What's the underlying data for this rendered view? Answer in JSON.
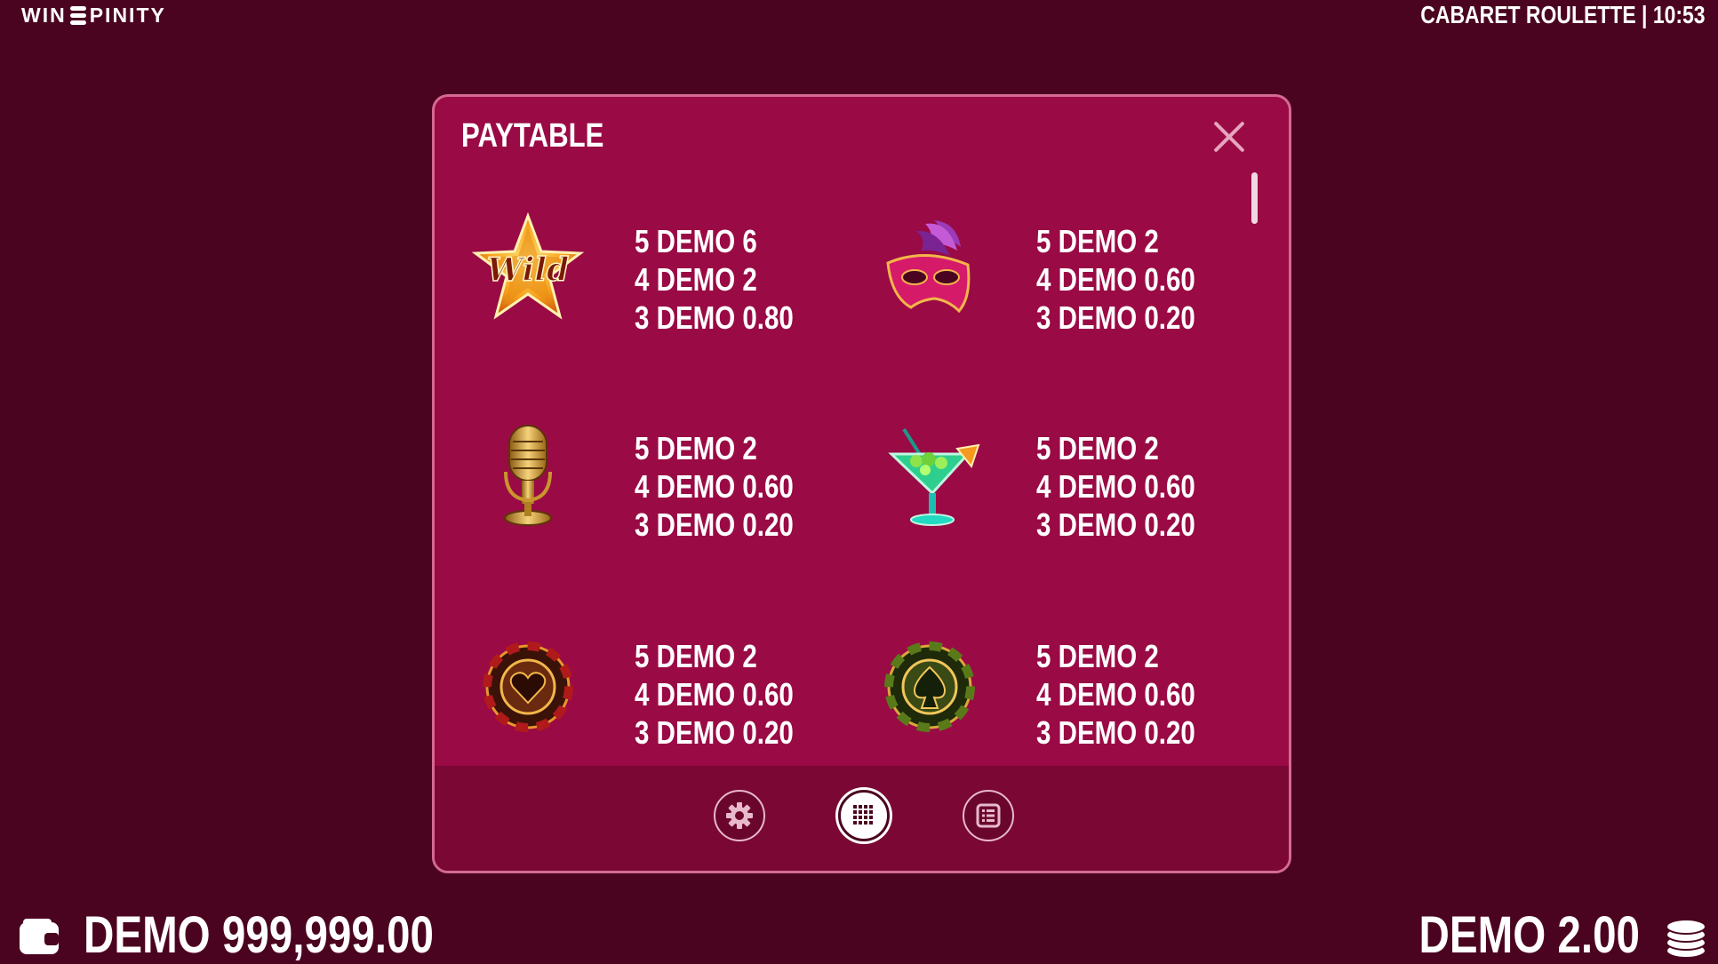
{
  "header": {
    "logo_text_left": "WIN",
    "logo_text_right": "PINITY",
    "game_title": "CABARET ROULETTE | 10:53"
  },
  "modal": {
    "title": "PAYTABLE",
    "items": [
      {
        "symbol": "wild-star-icon",
        "symbol_text": "Wild",
        "pays": [
          "5 DEMO 6",
          "4 DEMO 2",
          "3 DEMO 0.80"
        ]
      },
      {
        "symbol": "mask-icon",
        "pays": [
          "5 DEMO 2",
          "4 DEMO 0.60",
          "3 DEMO 0.20"
        ]
      },
      {
        "symbol": "microphone-icon",
        "pays": [
          "5 DEMO 2",
          "4 DEMO 0.60",
          "3 DEMO 0.20"
        ]
      },
      {
        "symbol": "cocktail-icon",
        "pays": [
          "5 DEMO 2",
          "4 DEMO 0.60",
          "3 DEMO 0.20"
        ]
      },
      {
        "symbol": "heart-chip-icon",
        "pays": [
          "5 DEMO 2",
          "4 DEMO 0.60",
          "3 DEMO 0.20"
        ]
      },
      {
        "symbol": "spade-chip-icon",
        "pays": [
          "5 DEMO 2",
          "4 DEMO 0.60",
          "3 DEMO 0.20"
        ]
      }
    ],
    "footer_buttons": [
      {
        "icon": "gear-icon",
        "active": false
      },
      {
        "icon": "grid-icon",
        "active": true
      },
      {
        "icon": "list-icon",
        "active": false
      }
    ]
  },
  "footer": {
    "balance": "DEMO 999,999.00",
    "bet": "DEMO 2.00"
  },
  "colors": {
    "background": "#4b0420",
    "modal": "#9a0a45",
    "modal_footer": "#7b0734",
    "modal_border": "#d36a92"
  }
}
